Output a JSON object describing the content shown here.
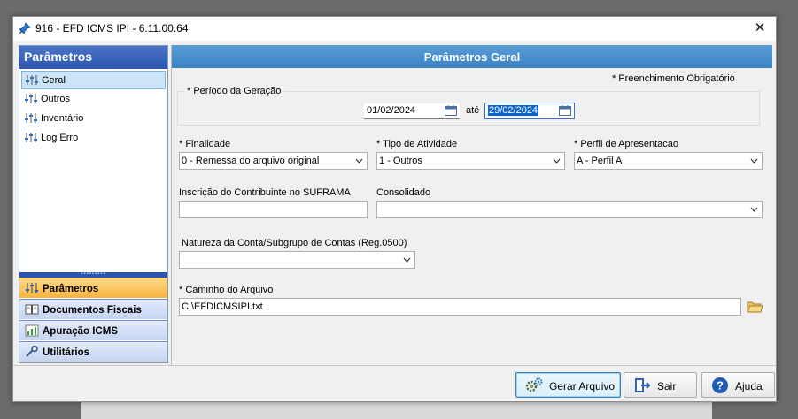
{
  "window": {
    "title": "916 - EFD ICMS IPI - 6.11.00.64",
    "close_glyph": "✕"
  },
  "left_panel": {
    "header": "Parâmetros",
    "tree_items": [
      {
        "label": "Geral",
        "selected": true
      },
      {
        "label": "Outros"
      },
      {
        "label": "Inventário"
      },
      {
        "label": "Log Erro"
      }
    ],
    "nav_items": [
      {
        "label": "Parâmetros",
        "icon": "sliders-icon",
        "active": true
      },
      {
        "label": "Documentos Fiscais",
        "icon": "book-icon"
      },
      {
        "label": "Apuração ICMS",
        "icon": "chart-icon"
      },
      {
        "label": "Utilitários",
        "icon": "wrench-icon"
      }
    ],
    "chevron": "»"
  },
  "main": {
    "header": "Parâmetros Geral",
    "required_note": "* Preenchimento Obrigatório",
    "periodo": {
      "legend": "* Período da Geração",
      "start": "01/02/2024",
      "separator": "até",
      "end": "29/02/2024"
    },
    "finalidade": {
      "label": "* Finalidade",
      "value": "0 - Remessa do arquivo original"
    },
    "tipo_atividade": {
      "label": "* Tipo de Atividade",
      "value": "1 - Outros"
    },
    "perfil": {
      "label": "* Perfil de Apresentacao",
      "value": "A - Perfil A"
    },
    "suframa": {
      "label": "Inscrição do Contribuinte no SUFRAMA",
      "value": ""
    },
    "consolidado": {
      "label": "Consolidado",
      "value": ""
    },
    "natureza": {
      "label": "Natureza da Conta/Subgrupo de Contas (Reg.0500)",
      "value": ""
    },
    "caminho": {
      "label": "* Caminho do Arquivo",
      "value": "C:\\EFDICMSIPI.txt"
    }
  },
  "buttons": {
    "gerar": "Gerar Arquivo",
    "sair": "Sair",
    "ajuda": "Ajuda"
  },
  "colors": {
    "left_header": "#2d56b0",
    "main_header": "#3c84c6",
    "active_nav": "#f7b43f"
  }
}
